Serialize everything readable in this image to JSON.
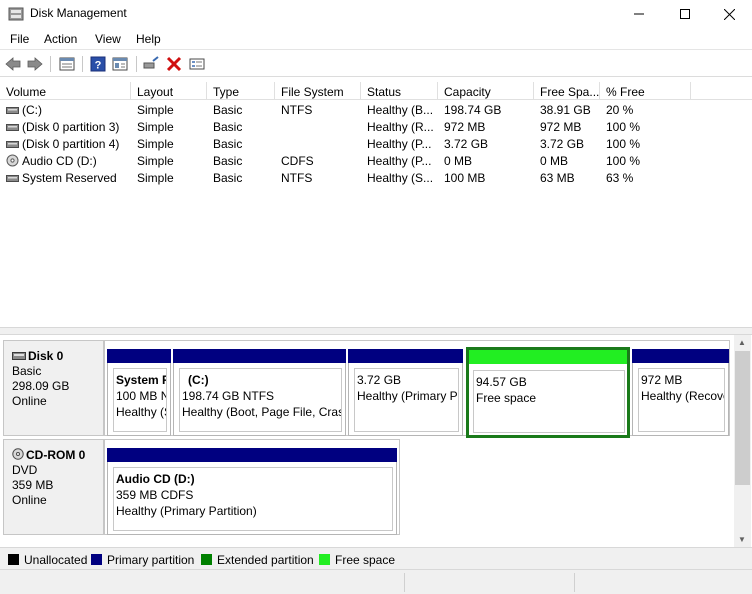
{
  "window": {
    "title": "Disk Management",
    "minimize_icon": "minimize-icon",
    "maximize_icon": "maximize-icon",
    "close_icon": "close-icon"
  },
  "menu": [
    "File",
    "Action",
    "View",
    "Help"
  ],
  "toolbar": [
    "back-arrow-icon",
    "forward-arrow-icon",
    "list-view-icon",
    "help-icon",
    "properties-icon",
    "connect-icon",
    "delete-icon",
    "format-icon"
  ],
  "volume_table": {
    "columns": [
      "Volume",
      "Layout",
      "Type",
      "File System",
      "Status",
      "Capacity",
      "Free Spa...",
      "% Free"
    ],
    "rows": [
      {
        "icon": "drive-icon",
        "cells": [
          "(C:)",
          "Simple",
          "Basic",
          "NTFS",
          "Healthy (B...",
          "198.74 GB",
          "38.91 GB",
          "20 %"
        ]
      },
      {
        "icon": "drive-icon",
        "cells": [
          "(Disk 0 partition 3)",
          "Simple",
          "Basic",
          "",
          "Healthy (R...",
          "972 MB",
          "972 MB",
          "100 %"
        ]
      },
      {
        "icon": "drive-icon",
        "cells": [
          "(Disk 0 partition 4)",
          "Simple",
          "Basic",
          "",
          "Healthy (P...",
          "3.72 GB",
          "3.72 GB",
          "100 %"
        ]
      },
      {
        "icon": "cd-icon",
        "cells": [
          "Audio CD (D:)",
          "Simple",
          "Basic",
          "CDFS",
          "Healthy (P...",
          "0 MB",
          "0 MB",
          "100 %"
        ]
      },
      {
        "icon": "drive-icon",
        "cells": [
          "System Reserved",
          "Simple",
          "Basic",
          "NTFS",
          "Healthy (S...",
          "100 MB",
          "63 MB",
          "63 %"
        ]
      }
    ]
  },
  "disks": [
    {
      "name": "Disk 0",
      "type": "Basic",
      "size": "298.09 GB",
      "status": "Online",
      "icon": "hard-disk-icon",
      "partitions": [
        {
          "kind": "primary",
          "lines": [
            "System R",
            "100 MB N",
            "Healthy (S"
          ]
        },
        {
          "kind": "primary",
          "lines": [
            "(C:)",
            "198.74 GB NTFS",
            "Healthy (Boot, Page File, Crash"
          ]
        },
        {
          "kind": "primary",
          "lines": [
            "",
            "3.72 GB",
            "Healthy (Primary Pa"
          ]
        },
        {
          "kind": "free",
          "lines": [
            "",
            "94.57 GB",
            "Free space"
          ]
        },
        {
          "kind": "primary",
          "lines": [
            "",
            "972 MB",
            "Healthy (Recove"
          ]
        }
      ]
    },
    {
      "name": "CD-ROM 0",
      "type": "DVD",
      "size": "359 MB",
      "status": "Online",
      "icon": "cd-rom-icon",
      "partitions": [
        {
          "kind": "primary",
          "lines": [
            "Audio CD  (D:)",
            "359 MB CDFS",
            "Healthy (Primary Partition)"
          ]
        }
      ]
    }
  ],
  "legend": [
    {
      "label": "Unallocated",
      "color": "#000000"
    },
    {
      "label": "Primary partition",
      "color": "#000080"
    },
    {
      "label": "Extended partition",
      "color": "#008000"
    },
    {
      "label": "Free space",
      "color": "#22ee22"
    }
  ],
  "colors": {
    "primary_bar": "#000080",
    "free_bar": "#22ee22",
    "selected_border": "#1a7a1a"
  }
}
